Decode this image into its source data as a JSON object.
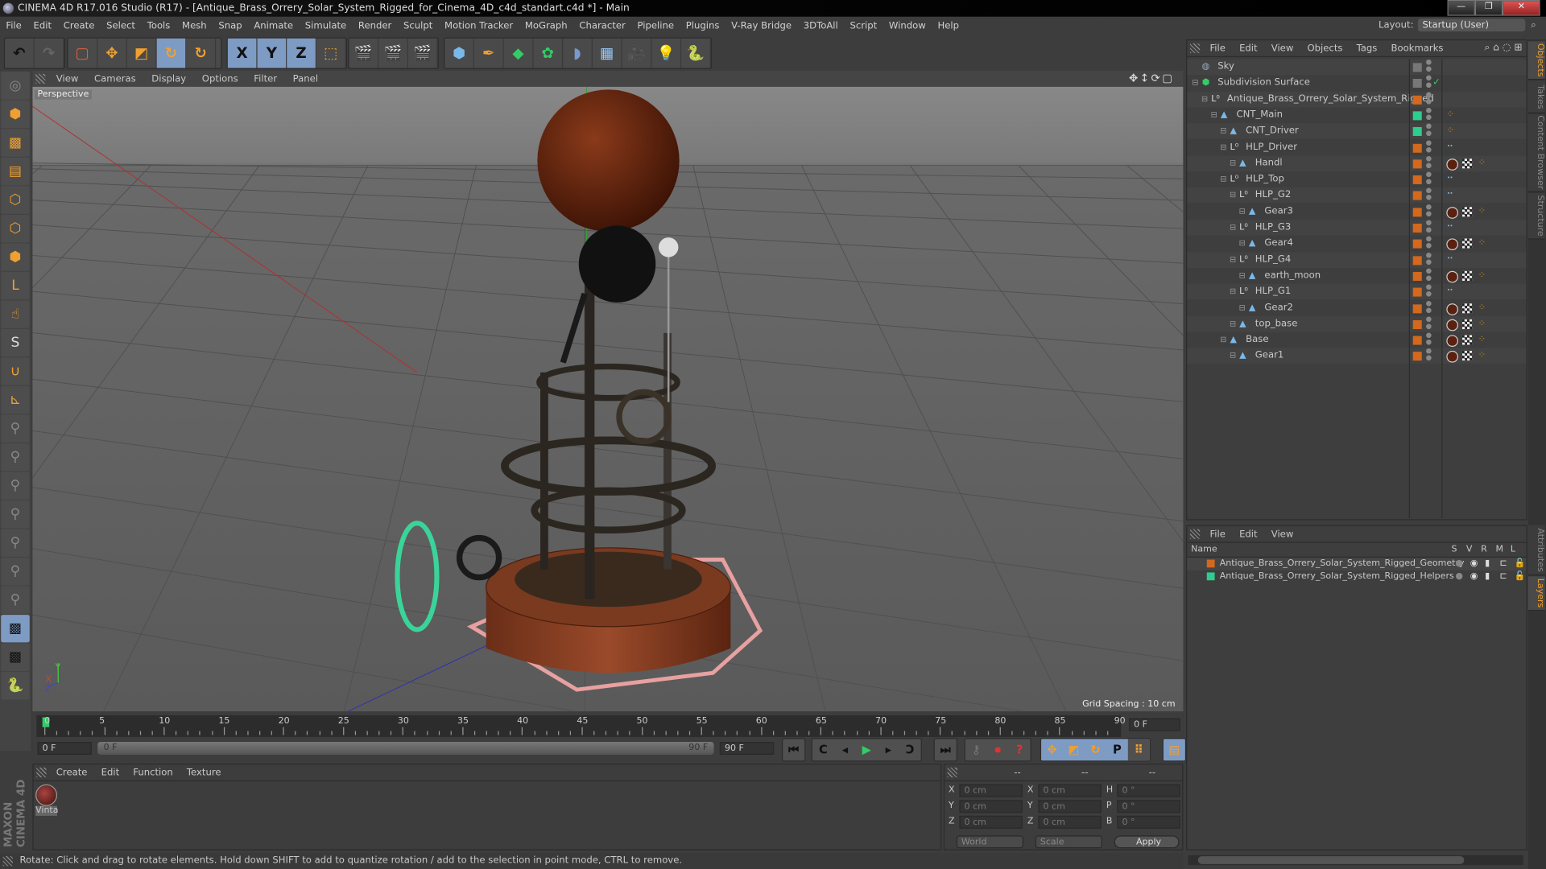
{
  "window": {
    "title": "CINEMA 4D R17.016 Studio (R17) - [Antique_Brass_Orrery_Solar_System_Rigged_for_Cinema_4D_c4d_standart.c4d *] - Main",
    "minimize": "—",
    "restore": "❐",
    "close": "✕"
  },
  "menu": [
    "File",
    "Edit",
    "Create",
    "Select",
    "Tools",
    "Mesh",
    "Snap",
    "Animate",
    "Simulate",
    "Render",
    "Sculpt",
    "Motion Tracker",
    "MoGraph",
    "Character",
    "Pipeline",
    "Plugins",
    "V-Ray Bridge",
    "3DToAll",
    "Script",
    "Window",
    "Help"
  ],
  "layout": {
    "label": "Layout:",
    "value": "Startup (User)"
  },
  "toolbar": {
    "x": "X",
    "y": "Y",
    "z": "Z"
  },
  "viewport": {
    "menu": [
      "View",
      "Cameras",
      "Display",
      "Options",
      "Filter",
      "Panel"
    ],
    "label": "Perspective",
    "grid_spacing": "Grid Spacing : 10 cm",
    "axis": {
      "x": "X",
      "y": "Y",
      "z": "Z"
    }
  },
  "timeline": {
    "ticks": [
      "0",
      "5",
      "10",
      "15",
      "20",
      "25",
      "30",
      "35",
      "40",
      "45",
      "50",
      "55",
      "60",
      "65",
      "70",
      "75",
      "80",
      "85",
      "90"
    ],
    "current_frame": "0 F",
    "start": "0 F",
    "range_start": "0 F",
    "range_end": "90 F",
    "end": "90 F",
    "playhead_fraction": 0
  },
  "material_panel": {
    "menu": [
      "Create",
      "Edit",
      "Function",
      "Texture"
    ],
    "materials": [
      {
        "name": "Vinta"
      }
    ]
  },
  "coordinates": {
    "headers": [
      "--",
      "--",
      "--"
    ],
    "rows": [
      {
        "l1": "X",
        "v1": "0 cm",
        "l2": "X",
        "v2": "0 cm",
        "l3": "H",
        "v3": "0 °"
      },
      {
        "l1": "Y",
        "v1": "0 cm",
        "l2": "Y",
        "v2": "0 cm",
        "l3": "P",
        "v3": "0 °"
      },
      {
        "l1": "Z",
        "v1": "0 cm",
        "l2": "Z",
        "v2": "0 cm",
        "l3": "B",
        "v3": "0 °"
      }
    ],
    "space": "World",
    "mode": "Scale",
    "apply": "Apply"
  },
  "status": "Rotate: Click and drag to rotate elements. Hold down SHIFT to add to quantize rotation / add to the selection in point mode, CTRL to remove.",
  "brand": "MAXON CINEMA 4D",
  "object_manager": {
    "menu": [
      "File",
      "Edit",
      "View",
      "Objects",
      "Tags",
      "Bookmarks"
    ],
    "objects": [
      {
        "name": "Sky",
        "depth": 0,
        "icon": "sky",
        "color": "#777777",
        "tags": ""
      },
      {
        "name": "Subdivision Surface",
        "depth": 0,
        "icon": "subdiv",
        "color": "#777777",
        "tags": "check"
      },
      {
        "name": "Antique_Brass_Orrery_Solar_System_Rigged",
        "depth": 1,
        "icon": "null",
        "color": "#d2691e",
        "tags": ""
      },
      {
        "name": "CNT_Main",
        "depth": 2,
        "icon": "joint",
        "color": "#2ecc8f",
        "tags": "ik"
      },
      {
        "name": "CNT_Driver",
        "depth": 3,
        "icon": "joint",
        "color": "#2ecc8f",
        "tags": "ik"
      },
      {
        "name": "HLP_Driver",
        "depth": 3,
        "icon": "null",
        "color": "#d2691e",
        "tags": "dots"
      },
      {
        "name": "Handl",
        "depth": 4,
        "icon": "joint",
        "color": "#d2691e",
        "tags": "mat"
      },
      {
        "name": "HLP_Top",
        "depth": 3,
        "icon": "null",
        "color": "#d2691e",
        "tags": "dots"
      },
      {
        "name": "HLP_G2",
        "depth": 4,
        "icon": "null",
        "color": "#d2691e",
        "tags": "dots"
      },
      {
        "name": "Gear3",
        "depth": 5,
        "icon": "joint",
        "color": "#d2691e",
        "tags": "mat"
      },
      {
        "name": "HLP_G3",
        "depth": 4,
        "icon": "null",
        "color": "#d2691e",
        "tags": "dots"
      },
      {
        "name": "Gear4",
        "depth": 5,
        "icon": "joint",
        "color": "#d2691e",
        "tags": "mat"
      },
      {
        "name": "HLP_G4",
        "depth": 4,
        "icon": "null",
        "color": "#d2691e",
        "tags": "dots"
      },
      {
        "name": "earth_moon",
        "depth": 5,
        "icon": "joint",
        "color": "#d2691e",
        "tags": "mat"
      },
      {
        "name": "HLP_G1",
        "depth": 4,
        "icon": "null",
        "color": "#d2691e",
        "tags": "dots"
      },
      {
        "name": "Gear2",
        "depth": 5,
        "icon": "joint",
        "color": "#d2691e",
        "tags": "mat"
      },
      {
        "name": "top_base",
        "depth": 4,
        "icon": "joint",
        "color": "#d2691e",
        "tags": "mat"
      },
      {
        "name": "Base",
        "depth": 3,
        "icon": "joint",
        "color": "#d2691e",
        "tags": "mat"
      },
      {
        "name": "Gear1",
        "depth": 4,
        "icon": "joint",
        "color": "#d2691e",
        "tags": "mat"
      }
    ]
  },
  "layer_manager": {
    "menu": [
      "File",
      "Edit",
      "View"
    ],
    "columns": [
      "Name",
      "S",
      "V",
      "R",
      "M",
      "L"
    ],
    "layers": [
      {
        "name": "Antique_Brass_Orrery_Solar_System_Rigged_Geometry",
        "color": "#d2691e"
      },
      {
        "name": "Antique_Brass_Orrery_Solar_System_Rigged_Helpers",
        "color": "#2ecc8f"
      }
    ]
  },
  "side_tabs": {
    "objects": "Objects",
    "takes": "Takes",
    "content": "Content Browser",
    "structure": "Structure",
    "attributes": "Attributes",
    "layers": "Layers"
  }
}
